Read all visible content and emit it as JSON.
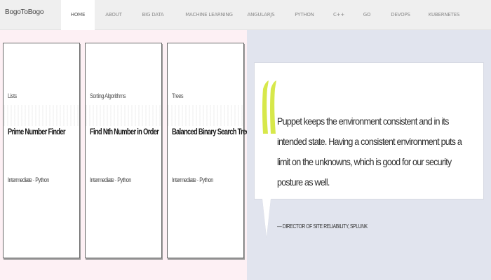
{
  "brand": "BogoToBogo",
  "nav": {
    "items": [
      {
        "label": "HOME",
        "active": true
      },
      {
        "label": "ABOUT",
        "active": false
      },
      {
        "label": "BIG DATA",
        "active": false
      },
      {
        "label": "MACHINE LEARNING",
        "active": false
      },
      {
        "label": "ANGULARJS",
        "active": false
      },
      {
        "label": "PYTHON",
        "active": false
      },
      {
        "label": "C++",
        "active": false
      },
      {
        "label": "GO",
        "active": false
      },
      {
        "label": "DEVOPS",
        "active": false
      },
      {
        "label": "KUBERNETES",
        "active": false
      }
    ]
  },
  "cards": [
    {
      "category": "Lists",
      "title": "Prime Number Finder",
      "meta": "Intermediate · Python"
    },
    {
      "category": "Sorting Algorithms",
      "title": "Find Nth Number in Order",
      "meta": "Intermediate · Python"
    },
    {
      "category": "Trees",
      "title": "Balanced Binary Search Tree",
      "meta": "Intermediate · Python"
    }
  ],
  "quote": {
    "text": "Puppet keeps the environment consistent and in its intended state. Having a consistent environment puts a limit on the unknowns, which is good for our security posture as well.",
    "author": "— DIRECTOR OF SITE RELIABILITY, SPLUNK",
    "mark_color": "#d7e84a"
  },
  "colors": {
    "left_bg": "#fdf0f4",
    "right_bg": "#e1e4ee",
    "nav_bg": "#efefef"
  }
}
